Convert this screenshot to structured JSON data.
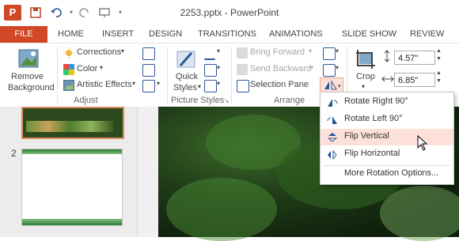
{
  "window": {
    "title": "2253.pptx - PowerPoint",
    "app_icon_letter": "P",
    "accent_color": "#d24726"
  },
  "tabs": [
    "FILE",
    "HOME",
    "INSERT",
    "DESIGN",
    "TRANSITIONS",
    "ANIMATIONS",
    "SLIDE SHOW",
    "REVIEW"
  ],
  "ribbon": {
    "adjust": {
      "remove_background": [
        "Remove",
        "Background"
      ],
      "corrections": "Corrections",
      "color": "Color",
      "artistic_effects": "Artistic Effects",
      "group_label": "Adjust"
    },
    "picture_styles": {
      "quick_styles": [
        "Quick",
        "Styles"
      ],
      "group_label": "Picture Styles"
    },
    "arrange": {
      "bring_forward": "Bring Forward",
      "send_backward": "Send Backward",
      "selection_pane": "Selection Pane",
      "group_label": "Arrange"
    },
    "size": {
      "crop": "Crop",
      "height": "4.57\"",
      "width": "6.85\""
    }
  },
  "slides": {
    "second_number": "2"
  },
  "rotate_menu": {
    "items": [
      {
        "label": "Rotate Right 90°",
        "icon": "rotate-right-icon"
      },
      {
        "label": "Rotate Left 90°",
        "icon": "rotate-left-icon"
      },
      {
        "label": "Flip Vertical",
        "icon": "flip-vertical-icon",
        "highlighted": true
      },
      {
        "label": "Flip Horizontal",
        "icon": "flip-horizontal-icon"
      },
      {
        "label": "More Rotation Options...",
        "icon": ""
      }
    ],
    "highlight_color": "#fde1d8"
  }
}
